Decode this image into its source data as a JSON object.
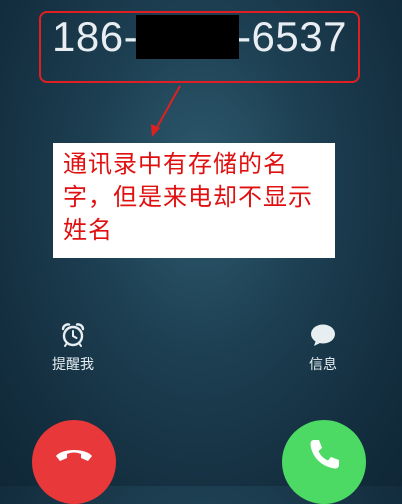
{
  "incoming_call": {
    "number_prefix": "186-",
    "number_suffix": "-6537",
    "redacted": true
  },
  "annotation": {
    "text": "通讯录中有存储的名字，但是来电却不显示姓名",
    "color": "#e01010"
  },
  "actions": {
    "remind_label": "提醒我",
    "message_label": "信息"
  },
  "buttons": {
    "decline_color": "#e8383a",
    "accept_color": "#4cd964"
  }
}
